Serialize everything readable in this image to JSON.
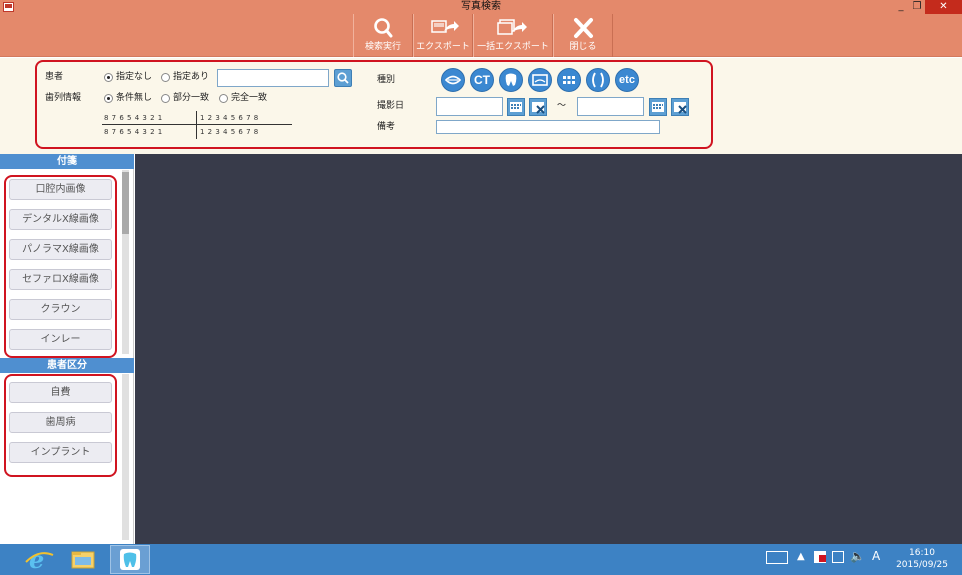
{
  "window": {
    "title": "写真検索",
    "controls": {
      "minimize": "_",
      "maximize": "❐",
      "close": "✕"
    }
  },
  "toolbar": {
    "buttons": [
      {
        "id": "search",
        "label": "検索実行",
        "icon": "search-icon"
      },
      {
        "id": "export",
        "label": "エクスポート",
        "icon": "export-icon"
      },
      {
        "id": "bulk_export",
        "label": "一括エクスポート",
        "icon": "bulk-export-icon"
      },
      {
        "id": "close",
        "label": "閉じる",
        "icon": "close-icon"
      }
    ]
  },
  "search": {
    "patient_label": "患者",
    "patient_options": [
      "指定なし",
      "指定あり"
    ],
    "patient_selected": "指定なし",
    "patient_value": "",
    "tooth_label": "歯列情報",
    "tooth_options": [
      "条件無し",
      "部分一致",
      "完全一致"
    ],
    "tooth_selected": "条件無し",
    "tooth_chart": {
      "upper_left": "8 7 6 5 4 3 2 1",
      "upper_right": "1 2 3 4 5 6 7 8",
      "lower_left": "8 7 6 5 4 3 2 1",
      "lower_right": "1 2 3 4 5 6 7 8"
    },
    "type_label": "種別",
    "type_buttons": [
      {
        "icon": "intraoral-icon",
        "text": ""
      },
      {
        "icon": "ct-icon",
        "text": "CT"
      },
      {
        "icon": "tooth-icon",
        "text": ""
      },
      {
        "icon": "panorama-icon",
        "text": ""
      },
      {
        "icon": "grid-icon",
        "text": ""
      },
      {
        "icon": "cephalo-icon",
        "text": ""
      },
      {
        "icon": "etc-icon",
        "text": "etc"
      }
    ],
    "date_label": "撮影日",
    "date_from": "",
    "date_to": "",
    "date_sep": "～",
    "note_label": "備考",
    "note_value": ""
  },
  "sidebar": {
    "tags_header": "付箋",
    "tags": [
      "口腔内画像",
      "デンタルX線画像",
      "パノラマX線画像",
      "セファロX線画像",
      "クラウン",
      "インレー"
    ],
    "patient_class_header": "患者区分",
    "patient_classes": [
      "自費",
      "歯周病",
      "インプラント"
    ]
  },
  "taskbar": {
    "apps": [
      "ie-icon",
      "file-explorer-icon",
      "dental-app-icon"
    ],
    "ime": "A",
    "time": "16:10",
    "date": "2015/09/25"
  }
}
